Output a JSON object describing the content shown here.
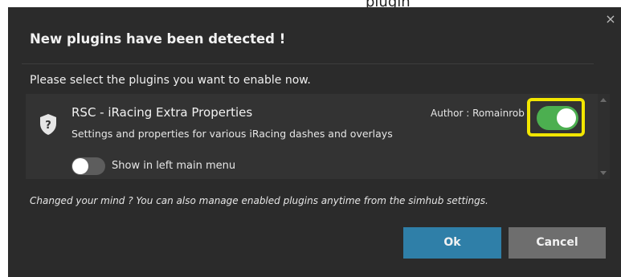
{
  "top_caption": "plugin",
  "dialog": {
    "close_label": "×",
    "title": "New plugins have been detected !",
    "subtitle": "Please select the plugins you want to enable now.",
    "plugin": {
      "icon": "shield-question-icon",
      "name": "RSC - iRacing Extra Properties",
      "description": "Settings and properties for various iRacing dashes and overlays",
      "author": "Author : Romainrob",
      "enabled": true,
      "show_in_menu": false,
      "show_in_menu_label": "Show in left main menu"
    },
    "note": "Changed your mind ? You can also manage enabled plugins anytime from the simhub settings.",
    "ok_label": "Ok",
    "cancel_label": "Cancel"
  },
  "colors": {
    "dialog_bg": "#2b2b2b",
    "card_bg": "#333333",
    "toggle_on": "#4caf50",
    "highlight": "#f2e600",
    "ok_button": "#2f7fa8",
    "cancel_button": "#6e6e6e"
  }
}
